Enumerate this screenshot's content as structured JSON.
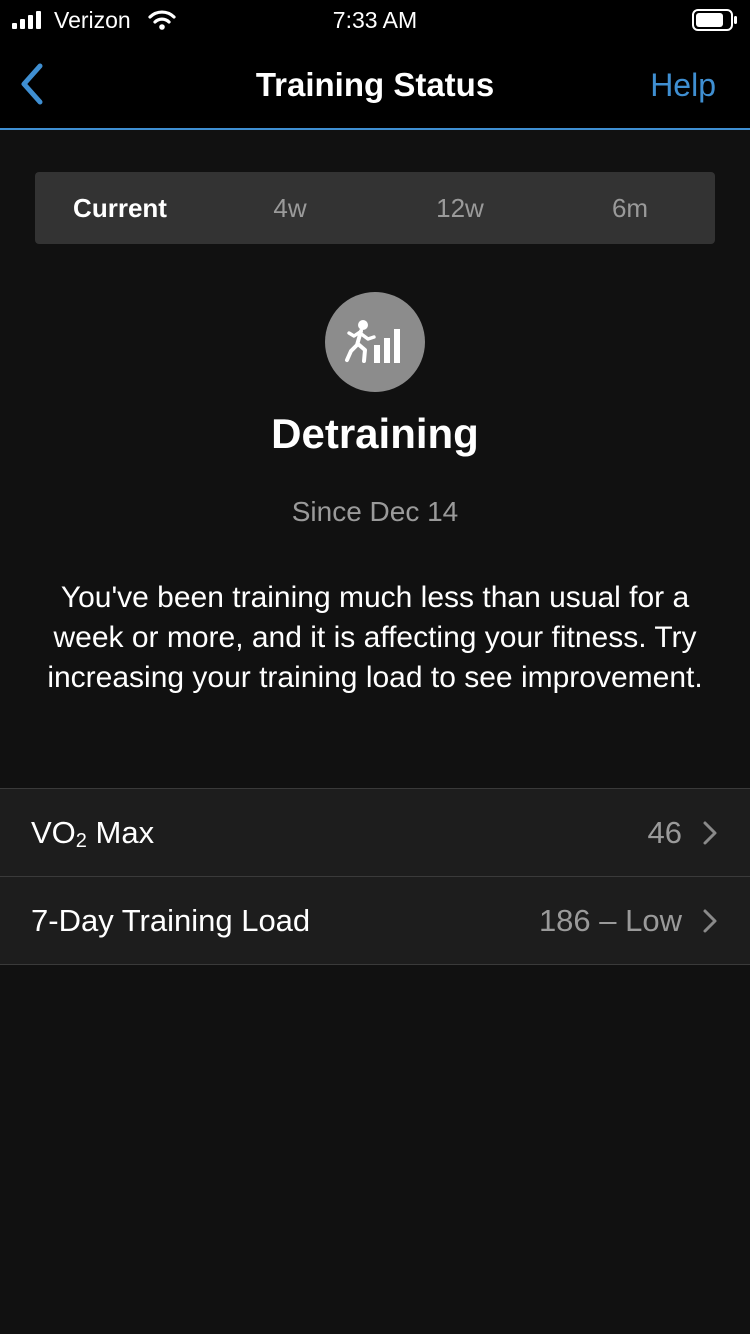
{
  "status_bar": {
    "carrier": "Verizon",
    "time": "7:33 AM"
  },
  "nav": {
    "title": "Training Status",
    "help_label": "Help"
  },
  "tabs": [
    {
      "label": "Current",
      "active": true
    },
    {
      "label": "4w",
      "active": false
    },
    {
      "label": "12w",
      "active": false
    },
    {
      "label": "6m",
      "active": false
    }
  ],
  "status": {
    "icon": "detraining-runner-bars-icon",
    "title": "Detraining",
    "since": "Since Dec 14",
    "description": "You've been training much less than usual for a week or more, and it is affecting your fitness. Try increasing your training load to see improvement."
  },
  "metrics": [
    {
      "label_prefix": "VO",
      "label_subscript": "2",
      "label_suffix": " Max",
      "value": "46"
    },
    {
      "label": "7-Day Training Load",
      "value": "186 – Low"
    }
  ],
  "colors": {
    "accent": "#3f8fd2",
    "background": "#111111",
    "row_background": "#1d1d1d",
    "secondary_text": "#9a9a9a",
    "status_icon_background": "#8c8c8c"
  }
}
